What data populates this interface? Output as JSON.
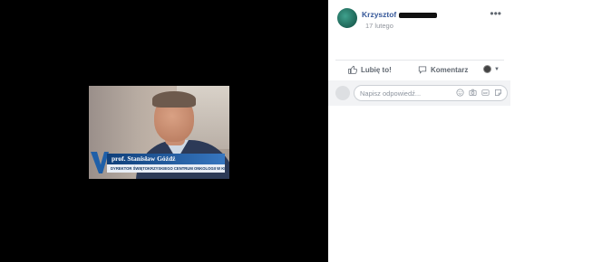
{
  "photo": {
    "tv_logo": "V",
    "name_caption": "prof. Stanisław Góźdź",
    "title_caption": "DYREKTOR ŚWIĘTOKRZYSKIEGO CENTRUM ONKOLOGII W KIELCACH"
  },
  "post": {
    "author": "Krzysztof",
    "timestamp": "17 lutego",
    "more_icon": "more-horizontal-icon"
  },
  "actions": {
    "like_label": "Lubię to!",
    "comment_label": "Komentarz"
  },
  "comment": {
    "placeholder": "Napisz odpowiedź..."
  },
  "colors": {
    "link": "#365899",
    "viewer_bg": "#000000",
    "tv_blue": "#1f5fa8"
  }
}
